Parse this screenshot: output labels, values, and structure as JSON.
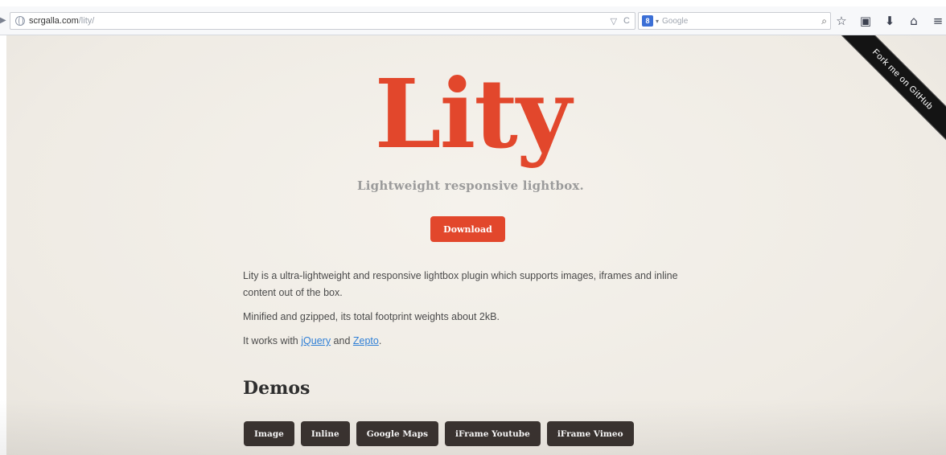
{
  "browser": {
    "url_host": "scrgalla.com",
    "url_path": "/lity/",
    "url_tools": [
      "▽",
      "C"
    ],
    "search_badge": "8",
    "search_placeholder": "Google",
    "icons": [
      "back-icon",
      "globe-icon",
      "magnifier-icon",
      "star-icon",
      "clipboard-icon",
      "download-icon",
      "home-icon",
      "menu-icon"
    ]
  },
  "page": {
    "ribbon_text": "Fork me on GitHub",
    "logo": "Lity",
    "tagline": "Lightweight responsive lightbox.",
    "download_label": "Download",
    "intro": "Lity is a ultra-lightweight and responsive lightbox plugin which supports images, iframes and inline content out of the box.",
    "footprint": "Minified and gzipped, its total footprint weights about 2kB.",
    "works_with_prefix": "It works with ",
    "jquery_link": "jQuery",
    "works_with_and": " and ",
    "zepto_link": "Zepto",
    "works_with_suffix": ".",
    "demos_heading": "Demos",
    "demo_buttons": [
      "Image",
      "Inline",
      "Google Maps",
      "iFrame Youtube",
      "iFrame Vimeo"
    ]
  },
  "colors": {
    "accent": "#e2472c",
    "dark_button": "#3b3431",
    "link": "#2f7fd6",
    "background": "#f1eee8"
  }
}
